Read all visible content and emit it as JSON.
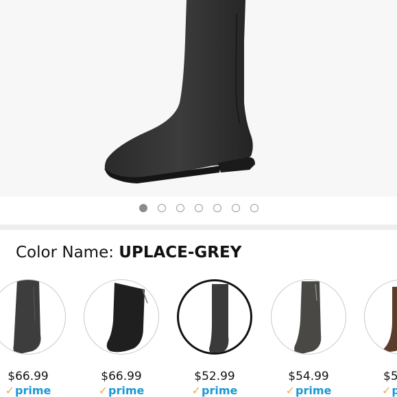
{
  "product_image": {
    "carousel": {
      "count": 7,
      "active_index": 0
    }
  },
  "variation": {
    "label": "Color Name:",
    "selected_value": "UPLACE-GREY"
  },
  "swatches": [
    {
      "price": "$66.99",
      "prime": "prime",
      "selected": false,
      "boot_color": "#3d3d3d"
    },
    {
      "price": "$66.99",
      "prime": "prime",
      "selected": false,
      "boot_color": "#1f1f1f"
    },
    {
      "price": "$52.99",
      "prime": "prime",
      "selected": true,
      "boot_color": "#3a3a3a"
    },
    {
      "price": "$54.99",
      "prime": "prime",
      "selected": false,
      "boot_color": "#4a4844"
    },
    {
      "price": "$5",
      "prime": "p",
      "selected": false,
      "boot_color": "#5a3e2b"
    }
  ],
  "colors": {
    "prime_blue": "#1a98d5",
    "prime_check": "#f3a847",
    "selected_border": "#111111"
  }
}
